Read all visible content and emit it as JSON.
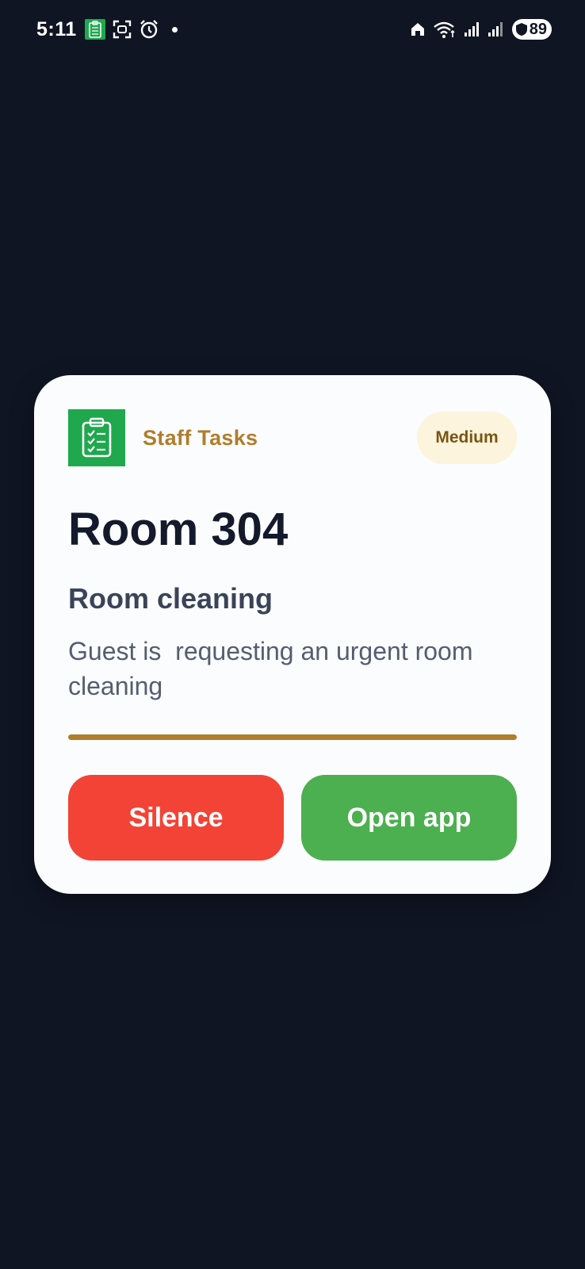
{
  "status_bar": {
    "time": "5:11",
    "battery_level": "89",
    "icons_left": [
      "staff-tasks-app-icon",
      "screenshot-icon",
      "alarm-icon",
      "dot-icon"
    ],
    "icons_right": [
      "home-icon",
      "wifi-icon",
      "signal-icon",
      "signal-icon",
      "battery-icon"
    ]
  },
  "notification": {
    "app_name": "Staff Tasks",
    "app_icon": "clipboard-checklist-icon",
    "priority": "Medium",
    "room": "Room 304",
    "task_type": "Room cleaning",
    "description": "Guest is  requesting an urgent room cleaning",
    "progress_fraction": 1.0,
    "actions": {
      "silence_label": "Silence",
      "open_label": "Open app"
    }
  },
  "colors": {
    "background": "#0f1523",
    "card": "#fbfcfd",
    "app_icon_green": "#1fa84e",
    "accent_gold": "#b07d2c",
    "badge_bg": "#fdf4dd",
    "silence_red": "#f34336",
    "open_green": "#4caf50"
  }
}
